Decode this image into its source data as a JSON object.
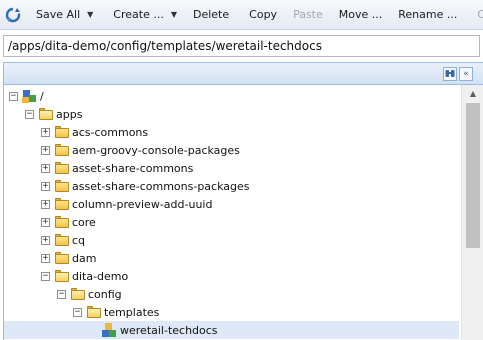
{
  "toolbar": {
    "save_all": "Save All",
    "create": "Create ...",
    "delete": "Delete",
    "copy": "Copy",
    "paste": "Paste",
    "move": "Move ...",
    "rename": "Rename ...",
    "overlay": "Overlay No"
  },
  "path": {
    "value": "/apps/dita-demo/config/templates/weretail-techdocs"
  },
  "tree": {
    "root": "/",
    "apps": "apps",
    "children": [
      "acs-commons",
      "aem-groovy-console-packages",
      "asset-share-commons",
      "asset-share-commons-packages",
      "column-preview-add-uuid",
      "core",
      "cq",
      "dam"
    ],
    "dita_demo": "dita-demo",
    "config": "config",
    "templates": "templates",
    "selected": "weretail-techdocs"
  },
  "colors": {
    "selection": "#dfe8f6",
    "folder": "#f3c34a",
    "panel_border": "#99bbe8"
  },
  "icons": [
    "refresh-icon",
    "find-icon",
    "collapse-icon",
    "folder-icon",
    "root-node-icon",
    "template-node-icon"
  ]
}
